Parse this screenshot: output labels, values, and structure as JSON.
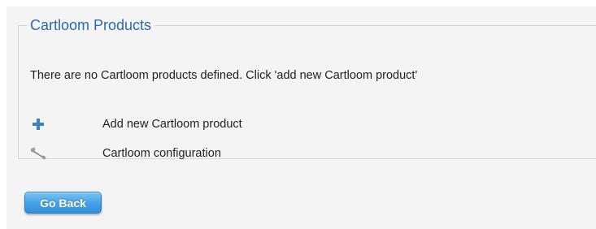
{
  "panel": {
    "title": "Cartloom Products",
    "message": "There are no Cartloom products defined. Click 'add new Cartloom product'"
  },
  "actions": [
    {
      "label": "Add new Cartloom product",
      "icon": "plus-icon",
      "color": "#3a82c4"
    },
    {
      "label": "Cartloom configuration",
      "icon": "wrench-icon",
      "color": "#9a9a9a"
    }
  ],
  "footer": {
    "go_back_label": "Go Back"
  },
  "colors": {
    "accent": "#2a6ab0",
    "button": "#47a3e6"
  }
}
